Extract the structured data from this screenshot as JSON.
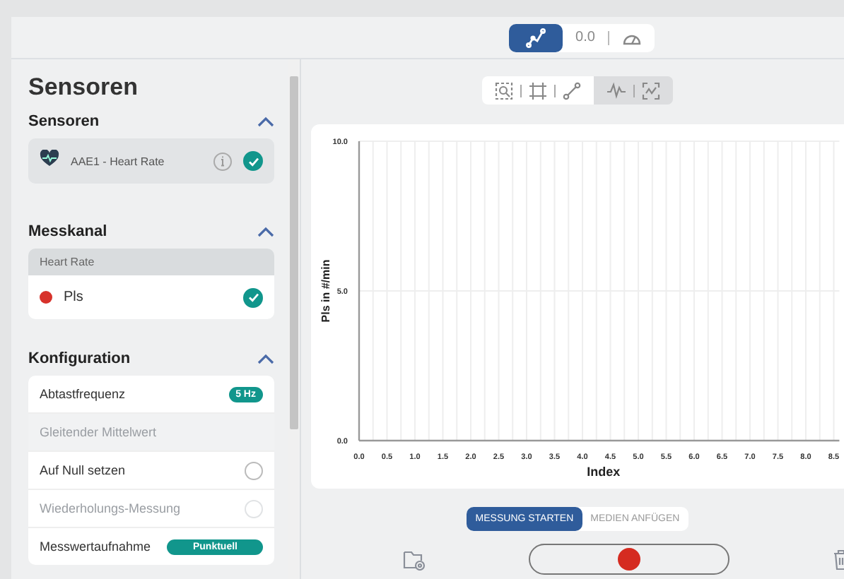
{
  "header": {
    "modes": [
      {
        "kind": "chart",
        "selected": true
      },
      {
        "kind": "reading",
        "label": "0.0",
        "selected": false
      },
      {
        "kind": "gauge",
        "selected": false
      }
    ]
  },
  "sidebar": {
    "title": "Sensoren",
    "sections": [
      {
        "title": "Sensoren",
        "expanded": true,
        "kind": "sensors",
        "items": [
          {
            "label": "AAE1 - Heart Rate",
            "checked": true
          }
        ]
      },
      {
        "title": "Messkanal",
        "expanded": true,
        "kind": "channels",
        "group": "Heart Rate",
        "items": [
          {
            "label": "Pls",
            "color": "#d7322b",
            "checked": true
          }
        ]
      },
      {
        "title": "Konfiguration",
        "expanded": true,
        "kind": "config",
        "items": [
          {
            "kind": "value",
            "label": "Abtastfrequenz",
            "value": "5 Hz",
            "disabled": false
          },
          {
            "kind": "plain",
            "label": "Gleitender Mittelwert",
            "disabled": true
          },
          {
            "kind": "toggle",
            "label": "Auf Null setzen",
            "checked": false,
            "disabled": false
          },
          {
            "kind": "toggle",
            "label": "Wiederholungs-Messung",
            "checked": false,
            "disabled": true
          },
          {
            "kind": "value",
            "label": "Messwertaufnahme",
            "value": "Punktuell",
            "disabled": false
          }
        ]
      }
    ]
  },
  "chart_tools": [
    {
      "shaded": false,
      "tools": [
        {
          "kind": "zoom"
        },
        {
          "kind": "crop"
        },
        {
          "kind": "line"
        }
      ]
    },
    {
      "shaded": true,
      "tools": [
        {
          "kind": "wave"
        },
        {
          "kind": "fit"
        }
      ]
    }
  ],
  "chart": {
    "chart_data": {
      "type": "line",
      "xlabel": "Index",
      "ylabel": "Pls in #/min",
      "xlim": [
        0,
        8.6
      ],
      "ylim": [
        0,
        10
      ],
      "grid": true,
      "xticks": [
        {
          "value": 0,
          "label": "0.0"
        },
        {
          "value": 0.5,
          "label": "0.5"
        },
        {
          "value": 1,
          "label": "1.0"
        },
        {
          "value": 1.5,
          "label": "1.5"
        },
        {
          "value": 2,
          "label": "2.0"
        },
        {
          "value": 2.5,
          "label": "2.5"
        },
        {
          "value": 3,
          "label": "3.0"
        },
        {
          "value": 3.5,
          "label": "3.5"
        },
        {
          "value": 4,
          "label": "4.0"
        },
        {
          "value": 4.5,
          "label": "4.5"
        },
        {
          "value": 5,
          "label": "5.0"
        },
        {
          "value": 5.5,
          "label": "5.5"
        },
        {
          "value": 6,
          "label": "6.0"
        },
        {
          "value": 6.5,
          "label": "6.5"
        },
        {
          "value": 7,
          "label": "7.0"
        },
        {
          "value": 7.5,
          "label": "7.5"
        },
        {
          "value": 8,
          "label": "8.0"
        },
        {
          "value": 8.5,
          "label": "8.5"
        }
      ],
      "yticks": [
        {
          "value": 0,
          "label": "0.0"
        },
        {
          "value": 5,
          "label": "5.0"
        },
        {
          "value": 10,
          "label": "10.0"
        }
      ]
    }
  },
  "actions": [
    {
      "label": "MESSUNG STARTEN",
      "selected": true
    },
    {
      "label": "MEDIEN ANFÜGEN",
      "selected": false
    }
  ],
  "controls": [
    {
      "kind": "folder"
    },
    {
      "kind": "record"
    },
    {
      "kind": "trash"
    }
  ]
}
